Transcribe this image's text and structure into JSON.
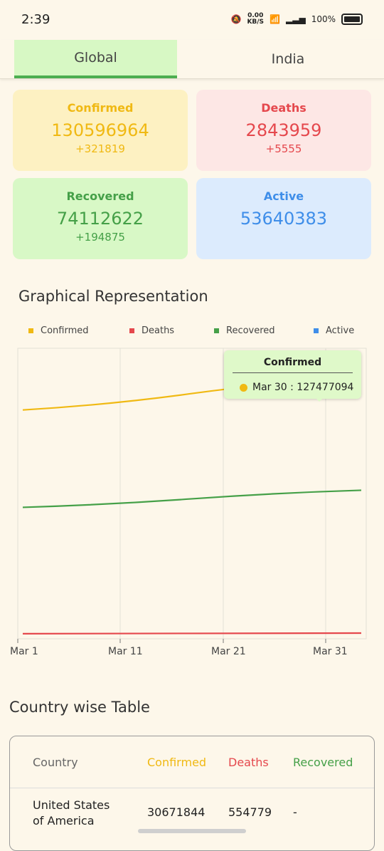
{
  "status_bar": {
    "time": "2:39",
    "net_speed": "0.00",
    "net_unit": "KB/S",
    "battery": "100%"
  },
  "tabs": [
    {
      "label": "Global",
      "selected": true
    },
    {
      "label": "India",
      "selected": false
    }
  ],
  "cards": {
    "confirmed": {
      "label": "Confirmed",
      "value": "130596964",
      "delta": "+321819"
    },
    "deaths": {
      "label": "Deaths",
      "value": "2843959",
      "delta": "+5555"
    },
    "recovered": {
      "label": "Recovered",
      "value": "74112622",
      "delta": "+194875"
    },
    "active": {
      "label": "Active",
      "value": "53640383"
    }
  },
  "graph": {
    "title": "Graphical Representation",
    "tooltip": {
      "title": "Confirmed",
      "text": "Mar 30 : 127477094"
    }
  },
  "colors": {
    "confirmed": "#f0b913",
    "deaths": "#e5484d",
    "recovered": "#45a048",
    "active": "#3f8ee9"
  },
  "chart_data": {
    "type": "line",
    "x": [
      "Mar 1",
      "Mar 31"
    ],
    "xticks": [
      "Mar 1",
      "Mar 11",
      "Mar 21",
      "Mar 31"
    ],
    "legend": [
      "Confirmed",
      "Deaths",
      "Recovered",
      "Active"
    ],
    "legend_position": "top",
    "series": [
      {
        "name": "Confirmed",
        "values": [
          114200000,
          130596964
        ]
      },
      {
        "name": "Deaths",
        "values": [
          2535000,
          2843959
        ]
      },
      {
        "name": "Recovered",
        "values": [
          65600000,
          74112622
        ]
      }
    ],
    "ylim": [
      0,
      145000000
    ],
    "grid": "vertical"
  },
  "table": {
    "title": "Country wise Table",
    "headers": {
      "country": "Country",
      "confirmed": "Confirmed",
      "deaths": "Deaths",
      "recovered": "Recovered"
    },
    "rows": [
      {
        "country_line1": "United States",
        "country_line2": "of America",
        "confirmed": "30671844",
        "deaths": "554779",
        "recovered": "-"
      }
    ]
  }
}
